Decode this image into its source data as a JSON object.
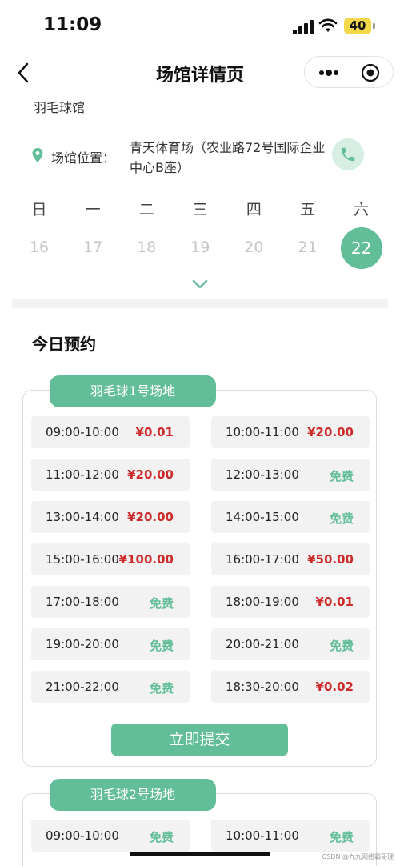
{
  "status_bar": {
    "time": "11:09",
    "battery": "40"
  },
  "nav": {
    "title": "场馆详情页"
  },
  "venue": {
    "name": "羽毛球馆",
    "location_label": "场馆位置：",
    "address": "青天体育场（农业路72号国际企业中心B座）"
  },
  "calendar": {
    "weekdays": [
      "日",
      "一",
      "二",
      "三",
      "四",
      "五",
      "六"
    ],
    "dates": [
      "16",
      "17",
      "18",
      "19",
      "20",
      "21",
      "22"
    ],
    "selected": "22"
  },
  "today": {
    "title": "今日预约"
  },
  "courts": [
    {
      "name": "羽毛球1号场地",
      "slots": [
        {
          "time": "09:00-10:00",
          "price": "¥0.01",
          "free": false
        },
        {
          "time": "10:00-11:00",
          "price": "¥20.00",
          "free": false
        },
        {
          "time": "11:00-12:00",
          "price": "¥20.00",
          "free": false
        },
        {
          "time": "12:00-13:00",
          "price": "免费",
          "free": true
        },
        {
          "time": "13:00-14:00",
          "price": "¥20.00",
          "free": false
        },
        {
          "time": "14:00-15:00",
          "price": "免费",
          "free": true
        },
        {
          "time": "15:00-16:00",
          "price": "¥100.00",
          "free": false
        },
        {
          "time": "16:00-17:00",
          "price": "¥50.00",
          "free": false
        },
        {
          "time": "17:00-18:00",
          "price": "免费",
          "free": true
        },
        {
          "time": "18:00-19:00",
          "price": "¥0.01",
          "free": false
        },
        {
          "time": "19:00-20:00",
          "price": "免费",
          "free": true
        },
        {
          "time": "20:00-21:00",
          "price": "免费",
          "free": true
        },
        {
          "time": "21:00-22:00",
          "price": "免费",
          "free": true
        },
        {
          "time": "18:30-20:00",
          "price": "¥0.02",
          "free": false
        }
      ],
      "submit_label": "立即提交"
    },
    {
      "name": "羽毛球2号场地",
      "slots": [
        {
          "time": "09:00-10:00",
          "price": "免费",
          "free": true
        },
        {
          "time": "10:00-11:00",
          "price": "免费",
          "free": true
        }
      ]
    }
  ],
  "watermark": "CSDN @九九网络霸哥理",
  "colors": {
    "accent": "#62be99",
    "price_red": "#cf2a2a",
    "slot_bg": "#f2f2f2"
  }
}
